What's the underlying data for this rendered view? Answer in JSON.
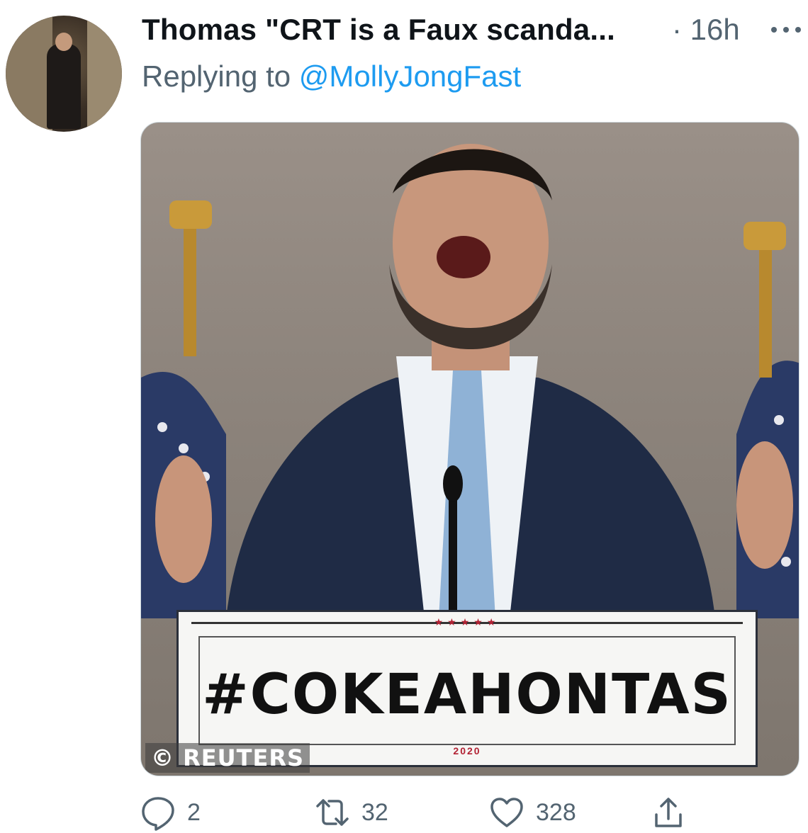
{
  "tweet": {
    "display_name": "Thomas \"CRT is a Faux scanda...",
    "separator": "·",
    "timestamp": "16h",
    "reply_prefix": "Replying to",
    "reply_handle": "@MollyJongFast",
    "more_icon": "more-dots-icon"
  },
  "media": {
    "podium_text": "#COKEAHONTAS",
    "podium_year": "2020",
    "podium_stars": "★★★★★",
    "credit": "© REUTERS"
  },
  "actions": {
    "reply": {
      "icon": "reply-icon",
      "count": "2"
    },
    "retweet": {
      "icon": "retweet-icon",
      "count": "32"
    },
    "like": {
      "icon": "like-icon",
      "count": "328"
    },
    "share": {
      "icon": "share-icon"
    }
  },
  "colors": {
    "link": "#1d9bf0",
    "secondary_text": "#536471",
    "primary_text": "#0f1419"
  }
}
